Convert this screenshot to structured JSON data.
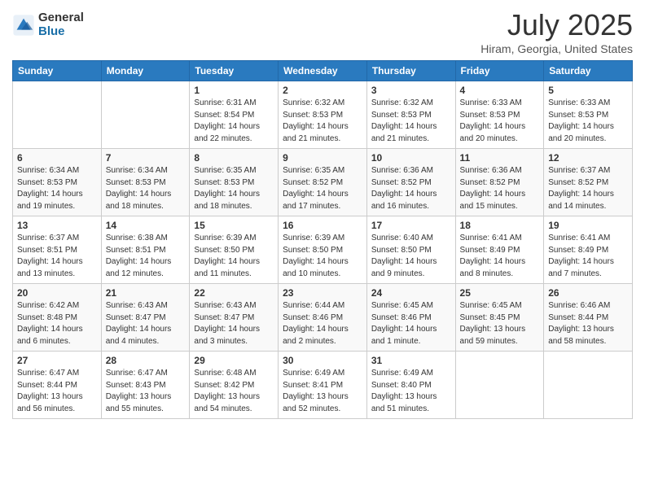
{
  "logo": {
    "general": "General",
    "blue": "Blue"
  },
  "header": {
    "month": "July 2025",
    "location": "Hiram, Georgia, United States"
  },
  "weekdays": [
    "Sunday",
    "Monday",
    "Tuesday",
    "Wednesday",
    "Thursday",
    "Friday",
    "Saturday"
  ],
  "weeks": [
    [
      {
        "day": "",
        "info": ""
      },
      {
        "day": "",
        "info": ""
      },
      {
        "day": "1",
        "info": "Sunrise: 6:31 AM\nSunset: 8:54 PM\nDaylight: 14 hours and 22 minutes."
      },
      {
        "day": "2",
        "info": "Sunrise: 6:32 AM\nSunset: 8:53 PM\nDaylight: 14 hours and 21 minutes."
      },
      {
        "day": "3",
        "info": "Sunrise: 6:32 AM\nSunset: 8:53 PM\nDaylight: 14 hours and 21 minutes."
      },
      {
        "day": "4",
        "info": "Sunrise: 6:33 AM\nSunset: 8:53 PM\nDaylight: 14 hours and 20 minutes."
      },
      {
        "day": "5",
        "info": "Sunrise: 6:33 AM\nSunset: 8:53 PM\nDaylight: 14 hours and 20 minutes."
      }
    ],
    [
      {
        "day": "6",
        "info": "Sunrise: 6:34 AM\nSunset: 8:53 PM\nDaylight: 14 hours and 19 minutes."
      },
      {
        "day": "7",
        "info": "Sunrise: 6:34 AM\nSunset: 8:53 PM\nDaylight: 14 hours and 18 minutes."
      },
      {
        "day": "8",
        "info": "Sunrise: 6:35 AM\nSunset: 8:53 PM\nDaylight: 14 hours and 18 minutes."
      },
      {
        "day": "9",
        "info": "Sunrise: 6:35 AM\nSunset: 8:52 PM\nDaylight: 14 hours and 17 minutes."
      },
      {
        "day": "10",
        "info": "Sunrise: 6:36 AM\nSunset: 8:52 PM\nDaylight: 14 hours and 16 minutes."
      },
      {
        "day": "11",
        "info": "Sunrise: 6:36 AM\nSunset: 8:52 PM\nDaylight: 14 hours and 15 minutes."
      },
      {
        "day": "12",
        "info": "Sunrise: 6:37 AM\nSunset: 8:52 PM\nDaylight: 14 hours and 14 minutes."
      }
    ],
    [
      {
        "day": "13",
        "info": "Sunrise: 6:37 AM\nSunset: 8:51 PM\nDaylight: 14 hours and 13 minutes."
      },
      {
        "day": "14",
        "info": "Sunrise: 6:38 AM\nSunset: 8:51 PM\nDaylight: 14 hours and 12 minutes."
      },
      {
        "day": "15",
        "info": "Sunrise: 6:39 AM\nSunset: 8:50 PM\nDaylight: 14 hours and 11 minutes."
      },
      {
        "day": "16",
        "info": "Sunrise: 6:39 AM\nSunset: 8:50 PM\nDaylight: 14 hours and 10 minutes."
      },
      {
        "day": "17",
        "info": "Sunrise: 6:40 AM\nSunset: 8:50 PM\nDaylight: 14 hours and 9 minutes."
      },
      {
        "day": "18",
        "info": "Sunrise: 6:41 AM\nSunset: 8:49 PM\nDaylight: 14 hours and 8 minutes."
      },
      {
        "day": "19",
        "info": "Sunrise: 6:41 AM\nSunset: 8:49 PM\nDaylight: 14 hours and 7 minutes."
      }
    ],
    [
      {
        "day": "20",
        "info": "Sunrise: 6:42 AM\nSunset: 8:48 PM\nDaylight: 14 hours and 6 minutes."
      },
      {
        "day": "21",
        "info": "Sunrise: 6:43 AM\nSunset: 8:47 PM\nDaylight: 14 hours and 4 minutes."
      },
      {
        "day": "22",
        "info": "Sunrise: 6:43 AM\nSunset: 8:47 PM\nDaylight: 14 hours and 3 minutes."
      },
      {
        "day": "23",
        "info": "Sunrise: 6:44 AM\nSunset: 8:46 PM\nDaylight: 14 hours and 2 minutes."
      },
      {
        "day": "24",
        "info": "Sunrise: 6:45 AM\nSunset: 8:46 PM\nDaylight: 14 hours and 1 minute."
      },
      {
        "day": "25",
        "info": "Sunrise: 6:45 AM\nSunset: 8:45 PM\nDaylight: 13 hours and 59 minutes."
      },
      {
        "day": "26",
        "info": "Sunrise: 6:46 AM\nSunset: 8:44 PM\nDaylight: 13 hours and 58 minutes."
      }
    ],
    [
      {
        "day": "27",
        "info": "Sunrise: 6:47 AM\nSunset: 8:44 PM\nDaylight: 13 hours and 56 minutes."
      },
      {
        "day": "28",
        "info": "Sunrise: 6:47 AM\nSunset: 8:43 PM\nDaylight: 13 hours and 55 minutes."
      },
      {
        "day": "29",
        "info": "Sunrise: 6:48 AM\nSunset: 8:42 PM\nDaylight: 13 hours and 54 minutes."
      },
      {
        "day": "30",
        "info": "Sunrise: 6:49 AM\nSunset: 8:41 PM\nDaylight: 13 hours and 52 minutes."
      },
      {
        "day": "31",
        "info": "Sunrise: 6:49 AM\nSunset: 8:40 PM\nDaylight: 13 hours and 51 minutes."
      },
      {
        "day": "",
        "info": ""
      },
      {
        "day": "",
        "info": ""
      }
    ]
  ]
}
